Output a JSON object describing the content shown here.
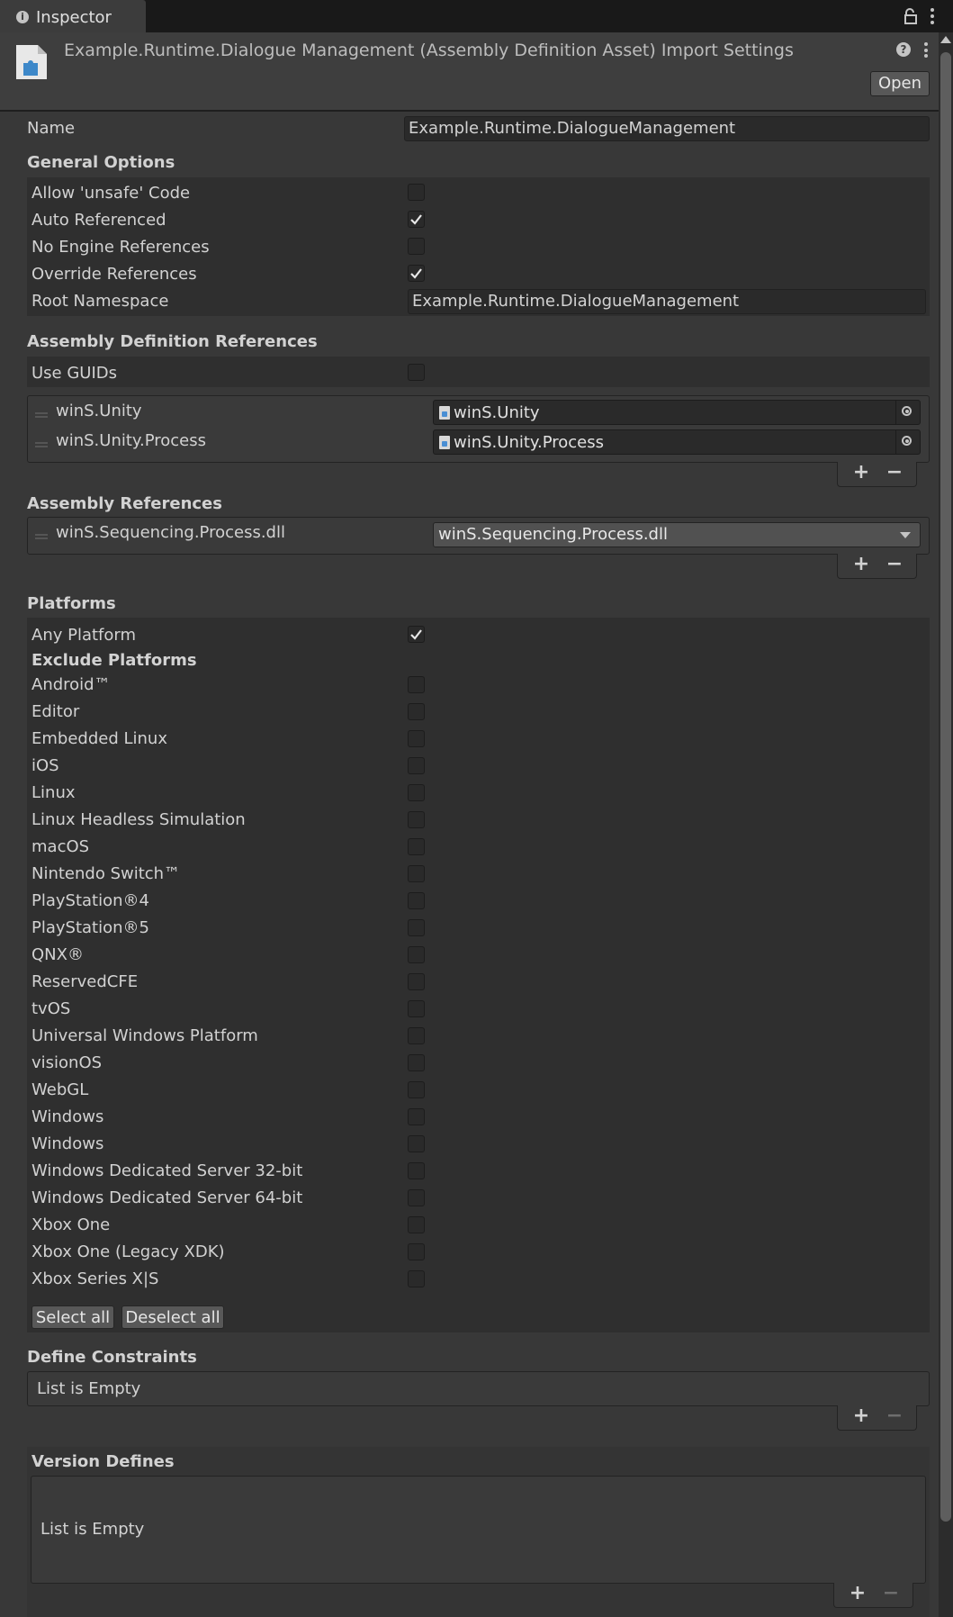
{
  "tab": {
    "label": "Inspector"
  },
  "header": {
    "title": "Example.Runtime.Dialogue Management (Assembly Definition Asset) Import Settings",
    "open_label": "Open"
  },
  "name_field": {
    "label": "Name",
    "value": "Example.Runtime.DialogueManagement"
  },
  "general": {
    "title": "General Options",
    "allow_unsafe": {
      "label": "Allow 'unsafe' Code",
      "checked": false
    },
    "auto_referenced": {
      "label": "Auto Referenced",
      "checked": true
    },
    "no_engine_refs": {
      "label": "No Engine References",
      "checked": false
    },
    "override_refs": {
      "label": "Override References",
      "checked": true
    },
    "root_namespace": {
      "label": "Root Namespace",
      "value": "Example.Runtime.DialogueManagement"
    }
  },
  "asmdef_refs": {
    "title": "Assembly Definition References",
    "use_guids": {
      "label": "Use GUIDs",
      "checked": false
    },
    "items": [
      {
        "label": "winS.Unity",
        "value": "winS.Unity"
      },
      {
        "label": "winS.Unity.Process",
        "value": "winS.Unity.Process"
      }
    ],
    "add": "+",
    "remove": "−"
  },
  "asm_refs": {
    "title": "Assembly References",
    "items": [
      {
        "label": "winS.Sequencing.Process.dll",
        "value": "winS.Sequencing.Process.dll"
      }
    ],
    "add": "+",
    "remove": "−"
  },
  "platforms": {
    "title": "Platforms",
    "any_platform": {
      "label": "Any Platform",
      "checked": true
    },
    "exclude_title": "Exclude Platforms",
    "list": [
      "Android™",
      "Editor",
      "Embedded Linux",
      "iOS",
      "Linux",
      "Linux Headless Simulation",
      "macOS",
      "Nintendo Switch™",
      "PlayStation®4",
      "PlayStation®5",
      "QNX®",
      "ReservedCFE",
      "tvOS",
      "Universal Windows Platform",
      "visionOS",
      "WebGL",
      "Windows",
      "Windows",
      "Windows Dedicated Server 32-bit",
      "Windows Dedicated Server 64-bit",
      "Xbox One",
      "Xbox One (Legacy XDK)",
      "Xbox Series X|S"
    ],
    "select_all": "Select all",
    "deselect_all": "Deselect all"
  },
  "define_constraints": {
    "title": "Define Constraints",
    "empty": "List is Empty",
    "add": "+",
    "remove": "−"
  },
  "version_defines": {
    "title": "Version Defines",
    "empty": "List is Empty",
    "add": "+",
    "remove": "−"
  }
}
